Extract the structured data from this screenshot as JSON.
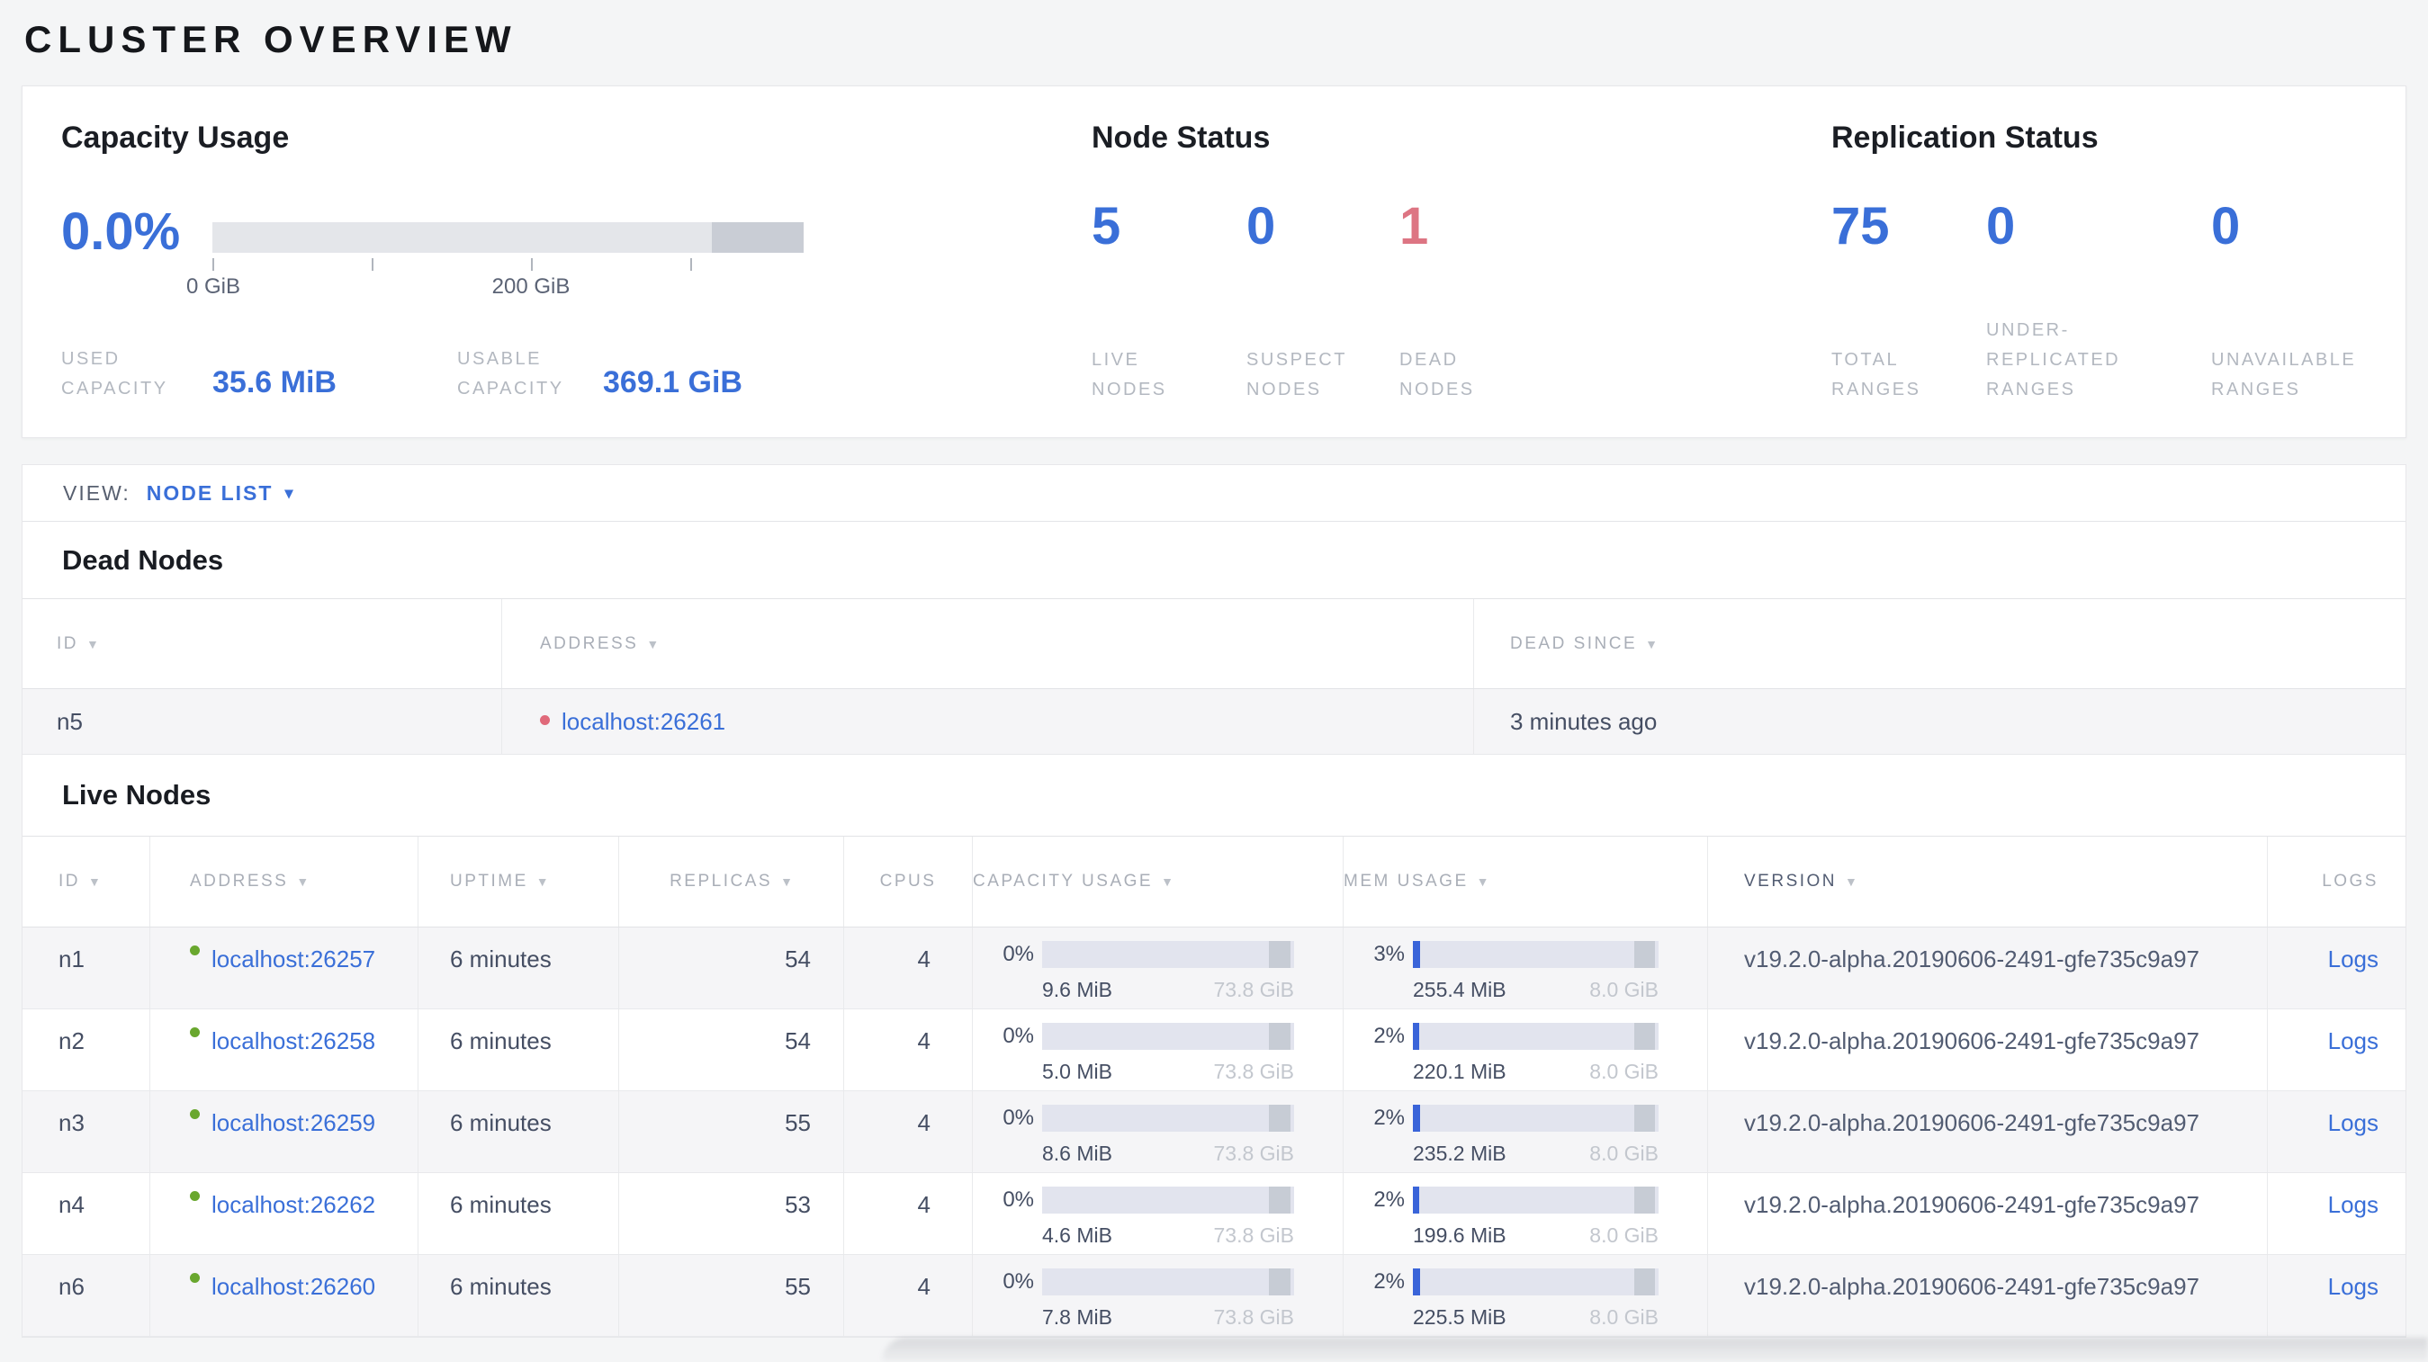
{
  "page_title": "CLUSTER OVERVIEW",
  "icons": {
    "sort": "▼",
    "caret": "▾"
  },
  "overview": {
    "capacity": {
      "title": "Capacity Usage",
      "percent": "0.0%",
      "tick_labels": [
        "0 GiB",
        "200 GiB"
      ],
      "used_label": "USED CAPACITY",
      "used_value": "35.6 MiB",
      "usable_label": "USABLE CAPACITY",
      "usable_value": "369.1 GiB"
    },
    "node_status": {
      "title": "Node Status",
      "stats": [
        {
          "value": "5",
          "label": "LIVE NODES",
          "color": "blue"
        },
        {
          "value": "0",
          "label": "SUSPECT NODES",
          "color": "blue"
        },
        {
          "value": "1",
          "label": "DEAD NODES",
          "color": "red"
        }
      ]
    },
    "replication": {
      "title": "Replication Status",
      "stats": [
        {
          "value": "75",
          "label": "TOTAL RANGES",
          "color": "blue"
        },
        {
          "value": "0",
          "label": "UNDER-REPLICATED RANGES",
          "color": "blue"
        },
        {
          "value": "0",
          "label": "UNAVAILABLE RANGES",
          "color": "blue"
        }
      ]
    }
  },
  "view_bar": {
    "label": "VIEW:",
    "selected": "NODE LIST"
  },
  "dead_nodes": {
    "title": "Dead Nodes",
    "columns": [
      {
        "key": "id",
        "label": "ID",
        "sortable": true
      },
      {
        "key": "address",
        "label": "ADDRESS",
        "sortable": true
      },
      {
        "key": "dead_since",
        "label": "DEAD SINCE",
        "sortable": true
      }
    ],
    "rows": [
      {
        "id": "n5",
        "address": "localhost:26261",
        "dead_since": "3 minutes ago"
      }
    ]
  },
  "live_nodes": {
    "title": "Live Nodes",
    "columns": [
      {
        "key": "id",
        "label": "ID",
        "sortable": true,
        "head_align": "left"
      },
      {
        "key": "address",
        "label": "ADDRESS",
        "sortable": true,
        "head_align": "left"
      },
      {
        "key": "uptime",
        "label": "UPTIME",
        "sortable": true,
        "head_align": "left"
      },
      {
        "key": "replicas",
        "label": "REPLICAS",
        "sortable": true,
        "head_align": "center"
      },
      {
        "key": "cpus",
        "label": "CPUS",
        "sortable": false,
        "head_align": "center"
      },
      {
        "key": "capacity",
        "label": "CAPACITY USAGE",
        "sortable": true,
        "head_align": "left"
      },
      {
        "key": "mem",
        "label": "MEM USAGE",
        "sortable": true,
        "head_align": "left"
      },
      {
        "key": "version",
        "label": "VERSION",
        "sortable": true,
        "head_align": "left"
      },
      {
        "key": "logs",
        "label": "LOGS",
        "sortable": false,
        "head_align": "right"
      }
    ],
    "rows": [
      {
        "id": "n1",
        "address": "localhost:26257",
        "uptime": "6 minutes",
        "replicas": "54",
        "cpus": "4",
        "capacity": {
          "percent": "0%",
          "used": "9.6 MiB",
          "total": "73.8 GiB",
          "fill_pct": 0
        },
        "mem": {
          "percent": "3%",
          "used": "255.4 MiB",
          "total": "8.0 GiB",
          "fill_pct": 3.1
        },
        "version": "v19.2.0-alpha.20190606-2491-gfe735c9a97",
        "logs": "Logs"
      },
      {
        "id": "n2",
        "address": "localhost:26258",
        "uptime": "6 minutes",
        "replicas": "54",
        "cpus": "4",
        "capacity": {
          "percent": "0%",
          "used": "5.0 MiB",
          "total": "73.8 GiB",
          "fill_pct": 0
        },
        "mem": {
          "percent": "2%",
          "used": "220.1 MiB",
          "total": "8.0 GiB",
          "fill_pct": 2.7
        },
        "version": "v19.2.0-alpha.20190606-2491-gfe735c9a97",
        "logs": "Logs"
      },
      {
        "id": "n3",
        "address": "localhost:26259",
        "uptime": "6 minutes",
        "replicas": "55",
        "cpus": "4",
        "capacity": {
          "percent": "0%",
          "used": "8.6 MiB",
          "total": "73.8 GiB",
          "fill_pct": 0
        },
        "mem": {
          "percent": "2%",
          "used": "235.2 MiB",
          "total": "8.0 GiB",
          "fill_pct": 2.9
        },
        "version": "v19.2.0-alpha.20190606-2491-gfe735c9a97",
        "logs": "Logs"
      },
      {
        "id": "n4",
        "address": "localhost:26262",
        "uptime": "6 minutes",
        "replicas": "53",
        "cpus": "4",
        "capacity": {
          "percent": "0%",
          "used": "4.6 MiB",
          "total": "73.8 GiB",
          "fill_pct": 0
        },
        "mem": {
          "percent": "2%",
          "used": "199.6 MiB",
          "total": "8.0 GiB",
          "fill_pct": 2.4
        },
        "version": "v19.2.0-alpha.20190606-2491-gfe735c9a97",
        "logs": "Logs"
      },
      {
        "id": "n6",
        "address": "localhost:26260",
        "uptime": "6 minutes",
        "replicas": "55",
        "cpus": "4",
        "capacity": {
          "percent": "0%",
          "used": "7.8 MiB",
          "total": "73.8 GiB",
          "fill_pct": 0
        },
        "mem": {
          "percent": "2%",
          "used": "225.5 MiB",
          "total": "8.0 GiB",
          "fill_pct": 2.8
        },
        "version": "v19.2.0-alpha.20190606-2491-gfe735c9a97",
        "logs": "Logs"
      }
    ]
  },
  "colors": {
    "accent_blue": "#3a6fd8",
    "alert_red": "#dd7583",
    "live_dot_green": "#69a72e",
    "dead_dot_red": "#e0697a",
    "bar_track": "#e2e4ee",
    "bar_reserved_dark": "#c7ccd5",
    "bar_fill_blue": "#3a64d9"
  }
}
